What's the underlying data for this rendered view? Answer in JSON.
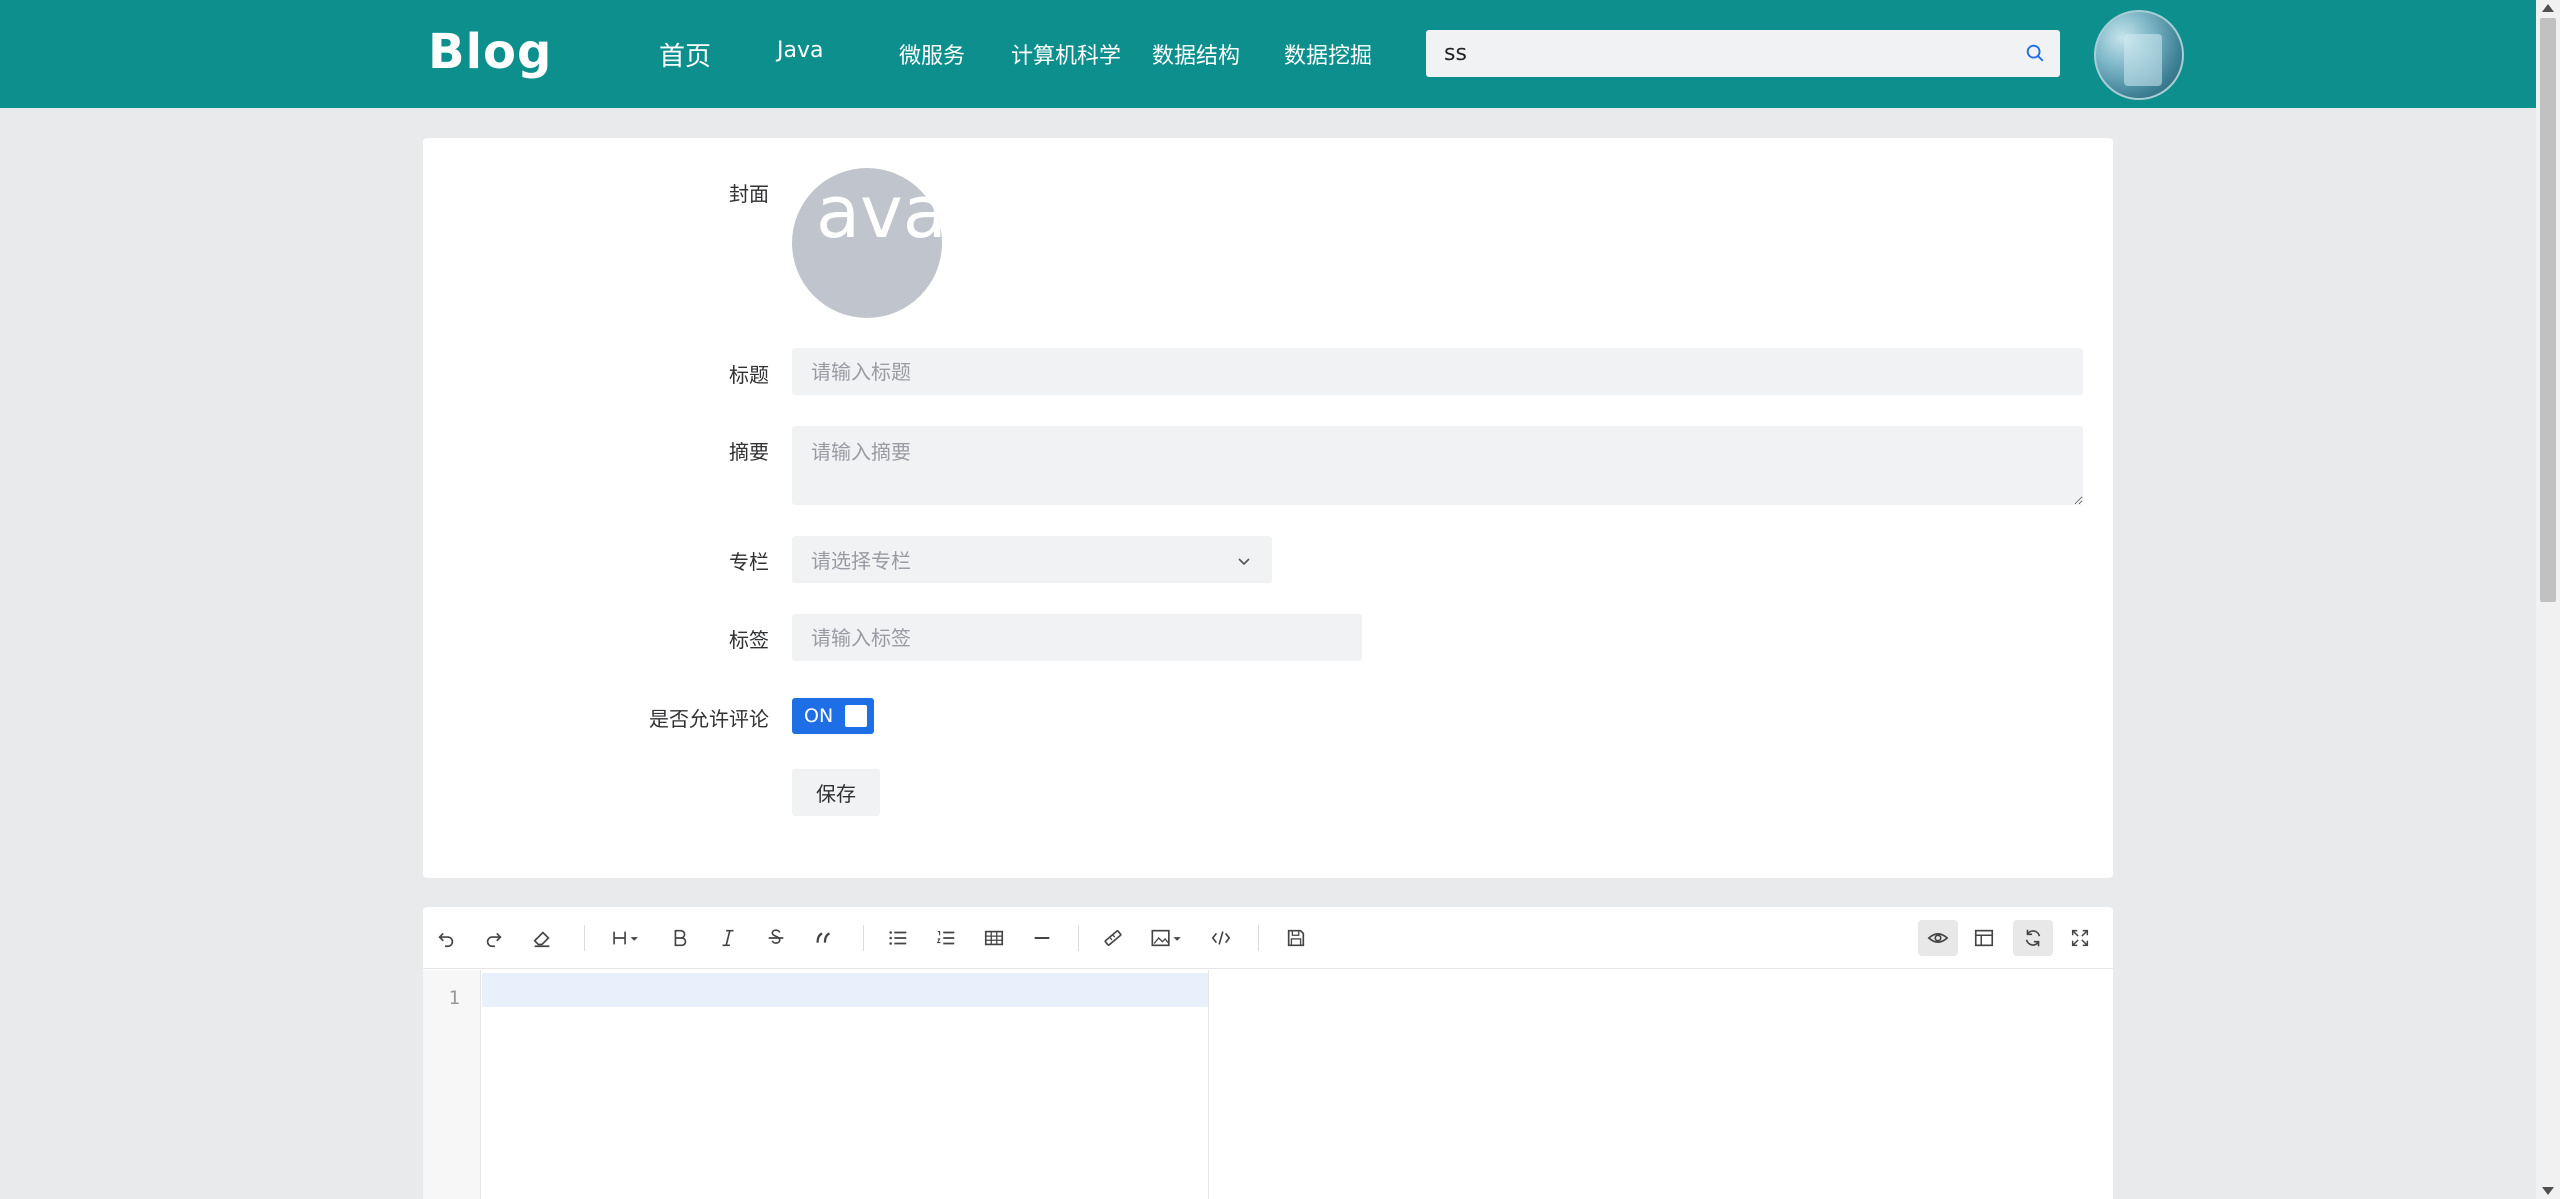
{
  "header": {
    "logo": "Blog",
    "nav": [
      {
        "label": "首页"
      },
      {
        "label": "Java"
      },
      {
        "label": "微服务"
      },
      {
        "label": "计算机科学"
      },
      {
        "label": "数据结构"
      },
      {
        "label": "数据挖掘"
      }
    ],
    "search": {
      "value": "ss"
    }
  },
  "form": {
    "cover": {
      "label": "封面",
      "placeholder_text": "ava"
    },
    "title": {
      "label": "标题",
      "placeholder": "请输入标题"
    },
    "summary": {
      "label": "摘要",
      "placeholder": "请输入摘要"
    },
    "column": {
      "label": "专栏",
      "placeholder": "请选择专栏"
    },
    "tags": {
      "label": "标签",
      "placeholder": "请输入标签"
    },
    "allow_comments": {
      "label": "是否允许评论",
      "state": "ON"
    },
    "save_label": "保存"
  },
  "editor": {
    "line_numbers": [
      "1"
    ],
    "toolbar_left": [
      "undo-icon",
      "redo-icon",
      "eraser-icon",
      "heading-icon",
      "bold-icon",
      "italic-icon",
      "strikethrough-icon",
      "quote-icon",
      "unordered-list-icon",
      "ordered-list-icon",
      "table-icon",
      "horizontal-rule-icon",
      "link-icon",
      "image-icon",
      "code-icon",
      "save-icon"
    ],
    "toolbar_right": [
      "preview-icon",
      "html-preview-icon",
      "sync-scroll-icon",
      "fullscreen-icon"
    ]
  },
  "colors": {
    "header_bg": "#0d8f8d",
    "toggle_on": "#1e6fe6",
    "page_bg": "#e9eaec"
  }
}
